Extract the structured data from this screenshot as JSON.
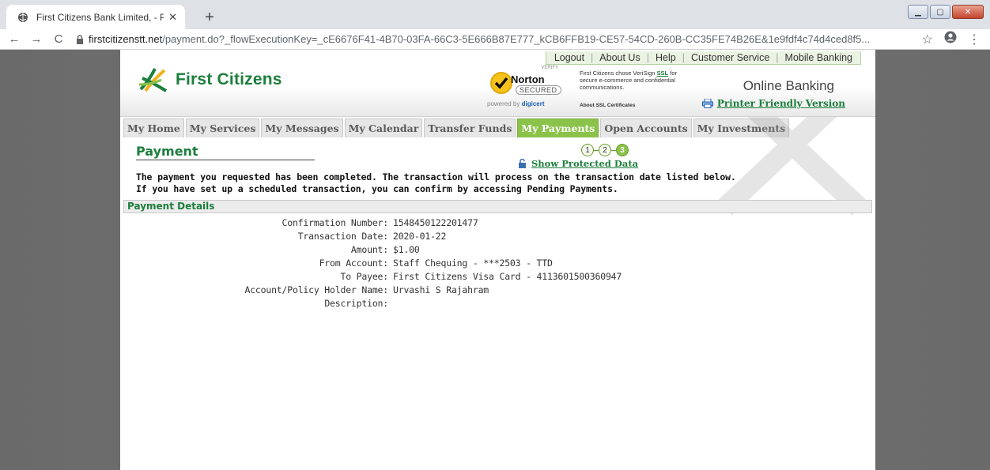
{
  "browser": {
    "tab_title": "First Citizens Bank Limited, - Pay",
    "new_tab": "+",
    "url_domain": "firstcitizenstt.net",
    "url_path": "/payment.do?_flowExecutionKey=_cE6676F41-4B70-03FA-66C3-5E666B87E777_kCB6FFB19-CE57-54CD-260B-CC35FE74B26E&1e9fdf4c74d4ced8f5...",
    "back": "←",
    "forward": "→",
    "reload": "C",
    "star": "☆",
    "menu": "⋮"
  },
  "header": {
    "toplinks": [
      "Logout",
      "About Us",
      "Help",
      "Customer Service",
      "Mobile Banking"
    ],
    "logo_text": "First Citizens",
    "norton": {
      "verify": "VERIFY",
      "name": "Norton",
      "secured": "SECURED",
      "powered_prefix": "powered by ",
      "powered_brand": "digicert"
    },
    "ssl_text_prefix": "First Citizens chose VeriSign ",
    "ssl_link": "SSL",
    "ssl_text_suffix": "for secure e-commerce and confidential communications.",
    "ssl_about": "About SSL Certificates",
    "online_banking": "Online Banking",
    "printer_link": "Printer Friendly Version"
  },
  "menu": {
    "items": [
      {
        "label": "My Home",
        "active": false
      },
      {
        "label": "My Services",
        "active": false
      },
      {
        "label": "My Messages",
        "active": false
      },
      {
        "label": "My Calendar",
        "active": false
      },
      {
        "label": "Transfer Funds",
        "active": false
      },
      {
        "label": "My Payments",
        "active": true
      },
      {
        "label": "Open Accounts",
        "active": false
      },
      {
        "label": "My Investments",
        "active": false
      }
    ]
  },
  "content": {
    "title": "Payment",
    "steps": [
      "1",
      "2",
      "3"
    ],
    "current_step": 3,
    "show_protected": "Show Protected Data",
    "message_line1": "The payment you requested has been completed. The transaction will process on the transaction date listed below.",
    "message_line2": "If you have set up a scheduled transaction, you can confirm by accessing Pending Payments.",
    "section_title": "Payment Details",
    "details": [
      {
        "label": "Confirmation Number:",
        "value": "1548450122201477"
      },
      {
        "label": "Transaction Date:",
        "value": "2020-01-22"
      },
      {
        "label": "Amount:",
        "value": "$1.00"
      },
      {
        "label": "From Account:",
        "value": "Staff Chequing - ***2503 - TTD"
      },
      {
        "label": "To Payee:",
        "value": "First Citizens Visa Card - 4113601500360947"
      },
      {
        "label": "Account/Policy Holder Name:",
        "value": "Urvashi S Rajahram"
      },
      {
        "label": "Description:",
        "value": ""
      }
    ]
  },
  "colors": {
    "brand_green": "#1c7e3c",
    "active_tab": "#8bc34a"
  }
}
